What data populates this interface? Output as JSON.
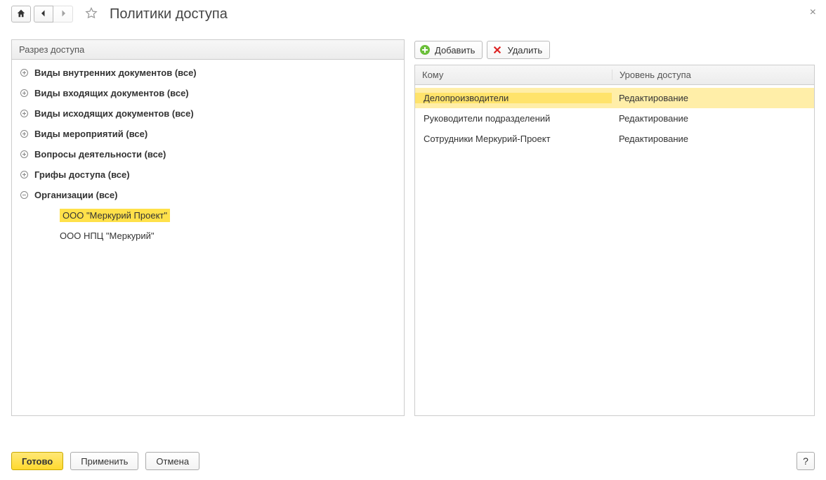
{
  "header": {
    "title": "Политики доступа"
  },
  "left_panel": {
    "header": "Разрез доступа",
    "tree": [
      {
        "label": "Виды внутренних документов (все)",
        "expanded": false,
        "children": []
      },
      {
        "label": "Виды входящих документов (все)",
        "expanded": false,
        "children": []
      },
      {
        "label": "Виды исходящих документов (все)",
        "expanded": false,
        "children": []
      },
      {
        "label": "Виды мероприятий (все)",
        "expanded": false,
        "children": []
      },
      {
        "label": "Вопросы деятельности (все)",
        "expanded": false,
        "children": []
      },
      {
        "label": "Грифы доступа (все)",
        "expanded": false,
        "children": []
      },
      {
        "label": "Организации (все)",
        "expanded": true,
        "children": [
          {
            "label": "ООО \"Меркурий Проект\"",
            "selected": true
          },
          {
            "label": "ООО НПЦ \"Меркурий\"",
            "selected": false
          }
        ]
      }
    ]
  },
  "right_panel": {
    "toolbar": {
      "add_label": "Добавить",
      "delete_label": "Удалить"
    },
    "columns": {
      "who": "Кому",
      "level": "Уровень доступа"
    },
    "rows": [
      {
        "who": "Делопроизводители",
        "level": "Редактирование",
        "selected": true
      },
      {
        "who": "Руководители подразделений",
        "level": "Редактирование",
        "selected": false
      },
      {
        "who": "Сотрудники Меркурий-Проект",
        "level": "Редактирование",
        "selected": false
      }
    ]
  },
  "footer": {
    "done": "Готово",
    "apply": "Применить",
    "cancel": "Отмена",
    "help": "?"
  }
}
